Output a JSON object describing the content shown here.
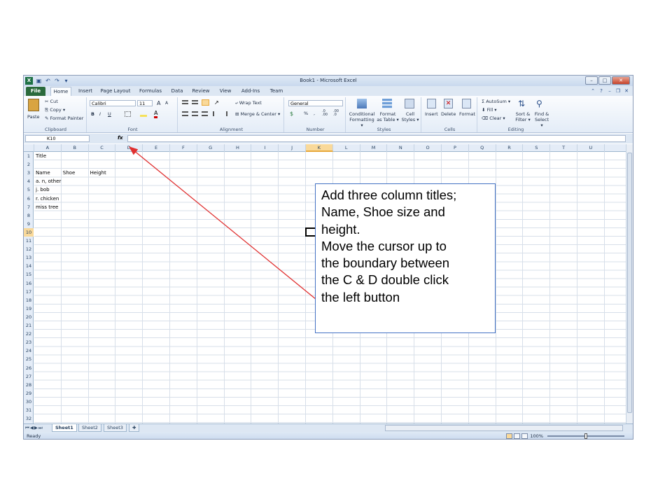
{
  "window": {
    "title": "Book1 - Microsoft Excel",
    "app_icon": "X",
    "quick_access_icons": [
      "save-icon",
      "undo-icon",
      "redo-icon",
      "customize-icon"
    ],
    "controls": [
      "–",
      "□",
      "✕"
    ]
  },
  "tabs": [
    {
      "label": "File",
      "type": "file"
    },
    {
      "label": "Home",
      "active": true
    },
    {
      "label": "Insert"
    },
    {
      "label": "Page Layout"
    },
    {
      "label": "Formulas"
    },
    {
      "label": "Data"
    },
    {
      "label": "Review"
    },
    {
      "label": "View"
    },
    {
      "label": "Add-Ins"
    },
    {
      "label": "Team"
    }
  ],
  "ribbon": {
    "clipboard": {
      "label": "Clipboard",
      "paste": "Paste",
      "cut": "Cut",
      "copy": "Copy ▾",
      "format_painter": "Format Painter"
    },
    "font": {
      "label": "Font",
      "font_name": "Calibri",
      "font_size": "11",
      "bold": "B",
      "italic": "I",
      "underline": "U",
      "grow": "A",
      "shrink": "A"
    },
    "alignment": {
      "label": "Alignment",
      "wrap_text": "Wrap Text",
      "merge_center": "Merge & Center ▾"
    },
    "number": {
      "label": "Number",
      "format": "General",
      "percent": "%",
      "comma": ",",
      "inc_decimal": ".0 .00",
      "dec_decimal": ".00 .0"
    },
    "styles": {
      "label": "Styles",
      "conditional": "Conditional Formatting ▾",
      "format_table": "Format as Table ▾",
      "cell_styles": "Cell Styles ▾"
    },
    "cells": {
      "label": "Cells",
      "insert": "Insert",
      "delete": "Delete",
      "format": "Format"
    },
    "editing": {
      "label": "Editing",
      "autosum": "AutoSum ▾",
      "fill": "Fill ▾",
      "clear": "Clear ▾",
      "sort_filter": "Sort & Filter ▾",
      "find_select": "Find & Select ▾"
    }
  },
  "formula_bar": {
    "name_box": "K10",
    "fx": "fx",
    "value": ""
  },
  "sheet": {
    "columns": [
      "A",
      "B",
      "C",
      "D",
      "E",
      "F",
      "G",
      "H",
      "I",
      "J",
      "K",
      "L",
      "M",
      "N",
      "O",
      "P",
      "Q",
      "R",
      "S",
      "T",
      "U"
    ],
    "selected_column": "K",
    "rows": 32,
    "selected_row": 10,
    "cells": [
      {
        "row": 1,
        "col": "A",
        "value": "Title"
      },
      {
        "row": 3,
        "col": "A",
        "value": "Name"
      },
      {
        "row": 3,
        "col": "B",
        "value": "Shoe"
      },
      {
        "row": 3,
        "col": "C",
        "value": "Height"
      },
      {
        "row": 4,
        "col": "A",
        "value": "a. n, other"
      },
      {
        "row": 5,
        "col": "A",
        "value": "j. bob"
      },
      {
        "row": 6,
        "col": "A",
        "value": "r. chicken"
      },
      {
        "row": 7,
        "col": "A",
        "value": "miss tree"
      }
    ]
  },
  "sheet_tabs": [
    {
      "label": "Sheet1",
      "active": true
    },
    {
      "label": "Sheet2"
    },
    {
      "label": "Sheet3"
    }
  ],
  "status": {
    "ready": "Ready",
    "zoom": "100%"
  },
  "callout": {
    "lines": [
      "Add three column titles;",
      "Name, Shoe size and",
      "height.",
      "Move the cursor up to",
      "the boundary between",
      "the C & D double click",
      "the left button"
    ]
  },
  "colors": {
    "annotation_arrow": "#e03030",
    "callout_border": "#4472c4",
    "file_tab": "#2a6a3c",
    "selection": "#f9d99a"
  }
}
